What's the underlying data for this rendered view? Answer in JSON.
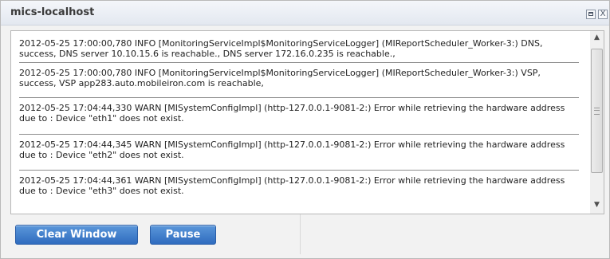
{
  "window": {
    "title": "mics-localhost",
    "controls": {
      "maximize_icon": "maximize-icon",
      "close_label": "X"
    }
  },
  "log": {
    "entries": [
      "2012-05-25 17:00:00,780 INFO [MonitoringServiceImpl$MonitoringServiceLogger] (MIReportScheduler_Worker-3:) DNS, success, DNS server 10.10.15.6 is reachable., DNS server 172.16.0.235 is reachable.,",
      "2012-05-25 17:00:00,780 INFO [MonitoringServiceImpl$MonitoringServiceLogger] (MIReportScheduler_Worker-3:) VSP, success, VSP app283.auto.mobileiron.com is reachable,",
      "2012-05-25 17:04:44,330 WARN [MISystemConfigImpl] (http-127.0.0.1-9081-2:) Error while retrieving the hardware address due to : Device \"eth1\" does not exist.",
      "2012-05-25 17:04:44,345 WARN [MISystemConfigImpl] (http-127.0.0.1-9081-2:) Error while retrieving the hardware address due to : Device \"eth2\" does not exist.",
      "2012-05-25 17:04:44,361 WARN [MISystemConfigImpl] (http-127.0.0.1-9081-2:) Error while retrieving the hardware address due to : Device \"eth3\" does not exist."
    ]
  },
  "scrollbar": {
    "up_glyph": "▲",
    "down_glyph": "▼"
  },
  "buttons": {
    "clear_window": "Clear Window",
    "pause": "Pause"
  },
  "colors": {
    "button_blue": "#3a78c9",
    "title_text": "#3a3a3a"
  }
}
